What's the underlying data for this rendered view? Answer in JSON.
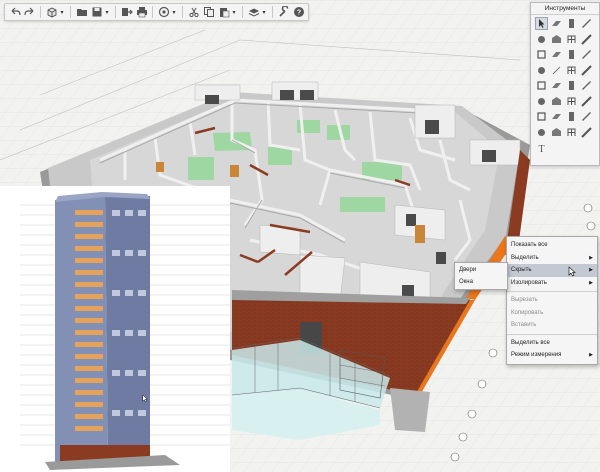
{
  "toolbar": {
    "buttons": [
      {
        "name": "undo-icon"
      },
      {
        "name": "redo-icon"
      },
      {
        "name": "view-3d-icon",
        "caret": true
      },
      {
        "name": "open-folder-icon"
      },
      {
        "name": "save-icon",
        "caret": true
      },
      {
        "name": "export-icon"
      },
      {
        "name": "print-icon"
      },
      {
        "name": "navigation-icon",
        "caret": true
      },
      {
        "name": "cut-icon"
      },
      {
        "name": "copy-icon"
      },
      {
        "name": "paste-icon",
        "caret": true
      },
      {
        "name": "layers-icon",
        "caret": true
      },
      {
        "name": "settings-wrench-icon"
      },
      {
        "name": "help-icon"
      }
    ]
  },
  "tools_palette": {
    "title": "Инструменты",
    "tools": [
      "select-arrow-icon",
      "rotate-select-icon",
      "wall-icon",
      "door-icon",
      "slab-icon",
      "beam-icon",
      "column-icon",
      "pencil-icon",
      "roof-icon",
      "eraser-icon",
      "window-icon",
      "brush-icon",
      "stair-icon",
      "line-icon",
      "lamp-icon",
      "fill-icon",
      "railing-icon",
      "shell-icon",
      "morph-icon",
      "object-icon",
      "zone-icon",
      "mesh-icon",
      "curtain-wall-icon",
      "skylight-icon",
      "label-icon",
      "dimension-icon",
      "section-icon",
      "elevation-icon",
      "camera-icon",
      "detail-icon",
      "worksheet-icon",
      "figure-icon",
      "text-icon"
    ]
  },
  "context_menu": {
    "items": [
      {
        "label": "Показать все",
        "state": "normal",
        "arrow": false
      },
      {
        "label": "Выделить",
        "state": "normal",
        "arrow": true
      },
      {
        "label": "Скрыть",
        "state": "hover",
        "arrow": true
      },
      {
        "label": "Изолировать",
        "state": "normal",
        "arrow": true
      },
      {
        "sep": true
      },
      {
        "label": "Вырезать",
        "state": "disabled",
        "arrow": false
      },
      {
        "label": "Копировать",
        "state": "disabled",
        "arrow": false
      },
      {
        "label": "Вставить",
        "state": "disabled",
        "arrow": false
      },
      {
        "sep": true
      },
      {
        "label": "Выделить все",
        "state": "normal",
        "arrow": false
      },
      {
        "label": "Режим измерения",
        "state": "normal",
        "arrow": true
      }
    ]
  },
  "submenu": {
    "items": [
      {
        "label": "Двери"
      },
      {
        "label": "Окна"
      }
    ]
  },
  "colors": {
    "brick": "#8a3b22",
    "wall": "#e9e9e9",
    "floor": "#b8b8b8",
    "green": "#9fd7a2",
    "orange": "#e8771d",
    "facade_blue": "#7a86b0",
    "facade_orange": "#e6a15a"
  }
}
